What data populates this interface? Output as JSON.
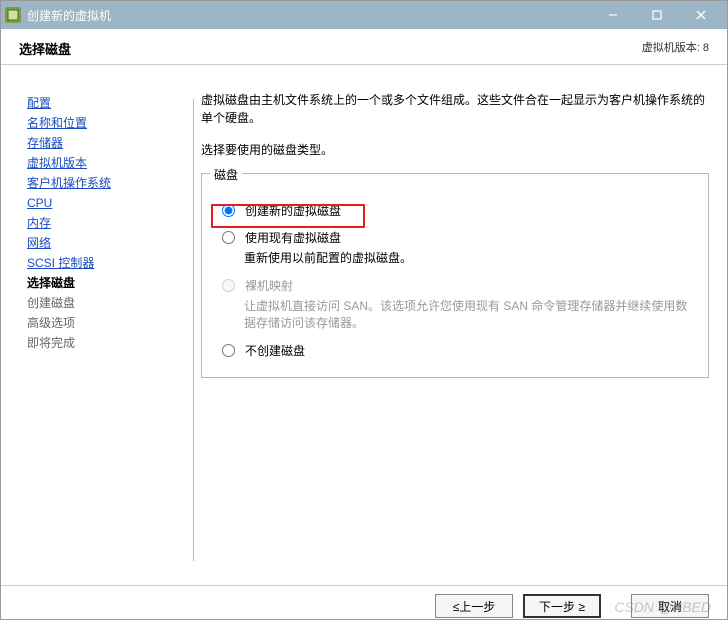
{
  "titlebar": {
    "title": "创建新的虚拟机"
  },
  "header": {
    "title": "选择磁盘",
    "version_label": "虚拟机版本: 8"
  },
  "sidebar": {
    "items": [
      {
        "label": "配置",
        "state": "done"
      },
      {
        "label": "名称和位置",
        "state": "done"
      },
      {
        "label": "存储器",
        "state": "done"
      },
      {
        "label": "虚拟机版本",
        "state": "done"
      },
      {
        "label": "客户机操作系统",
        "state": "done"
      },
      {
        "label": "CPU",
        "state": "done"
      },
      {
        "label": "内存",
        "state": "done"
      },
      {
        "label": "网络",
        "state": "done"
      },
      {
        "label": "SCSI 控制器",
        "state": "done"
      },
      {
        "label": "选择磁盘",
        "state": "current"
      },
      {
        "label": "创建磁盘",
        "state": "upcoming"
      },
      {
        "label": "高级选项",
        "state": "upcoming"
      },
      {
        "label": "即将完成",
        "state": "upcoming"
      }
    ]
  },
  "main": {
    "description": "虚拟磁盘由主机文件系统上的一个或多个文件组成。这些文件合在一起显示为客户机操作系统的单个硬盘。",
    "prompt": "选择要使用的磁盘类型。",
    "fieldset_legend": "磁盘",
    "options": [
      {
        "label": "创建新的虚拟磁盘",
        "sub": "",
        "selected": true,
        "enabled": true
      },
      {
        "label": "使用现有虚拟磁盘",
        "sub": "重新使用以前配置的虚拟磁盘。",
        "selected": false,
        "enabled": true
      },
      {
        "label": "裸机映射",
        "sub": "让虚拟机直接访问 SAN。该选项允许您使用现有 SAN 命令管理存储器并继续使用数据存储访问该存储器。",
        "selected": false,
        "enabled": false
      },
      {
        "label": "不创建磁盘",
        "sub": "",
        "selected": false,
        "enabled": true
      }
    ]
  },
  "footer": {
    "back_label": "≤上一步",
    "next_label": "下一步 ≥",
    "cancel_label": "取消"
  },
  "watermark": "CSDN @NBED"
}
